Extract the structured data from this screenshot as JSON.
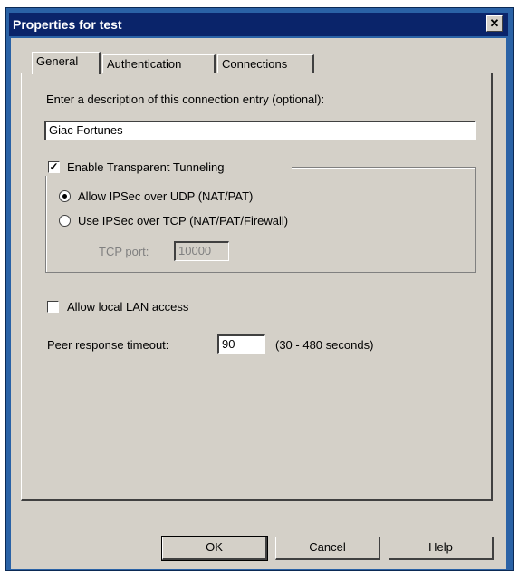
{
  "window": {
    "title": "Properties for test",
    "close_glyph": "✕"
  },
  "tabs": [
    {
      "label": "General",
      "active": true
    },
    {
      "label": "Authentication",
      "active": false
    },
    {
      "label": "Connections",
      "active": false
    }
  ],
  "general": {
    "description_prompt": "Enter a description of this connection entry (optional):",
    "description_value": "Giac Fortunes",
    "transparent_tunneling": {
      "label": "Enable Transparent Tunneling",
      "checked": true,
      "options": [
        {
          "label": "Allow IPSec over UDP  (NAT/PAT)",
          "selected": true
        },
        {
          "label": "Use IPSec over TCP  (NAT/PAT/Firewall)",
          "selected": false
        }
      ],
      "tcp_port_label": "TCP port:",
      "tcp_port_value": "10000"
    },
    "local_lan": {
      "label": "Allow local LAN access",
      "checked": false
    },
    "peer_timeout": {
      "label": "Peer response timeout:",
      "value": "90",
      "range_hint": "(30 - 480 seconds)"
    }
  },
  "buttons": {
    "ok": "OK",
    "cancel": "Cancel",
    "help": "Help"
  },
  "check_glyph": "✓"
}
